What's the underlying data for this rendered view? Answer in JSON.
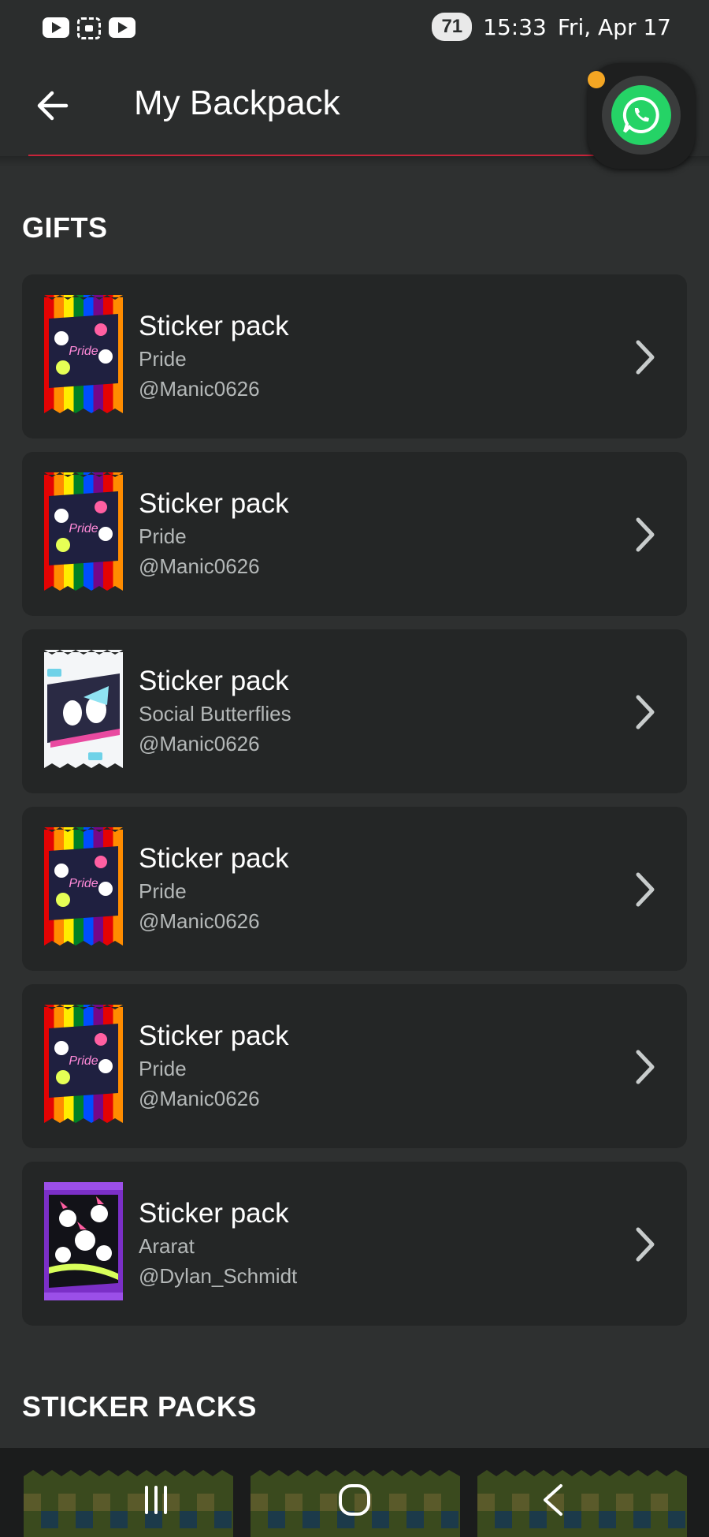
{
  "status_bar": {
    "icons": [
      "youtube-icon",
      "screenshot-icon",
      "youtube-icon"
    ],
    "battery": "71",
    "time": "15:33",
    "date": "Fri, Apr 17"
  },
  "app_bar": {
    "title": "My Backpack",
    "back_icon": "arrow-left-icon"
  },
  "floating_button": {
    "icon": "whatsapp-icon",
    "color": "#25d366"
  },
  "gifts": {
    "header": "GIFTS",
    "items": [
      {
        "title": "Sticker pack",
        "pack": "Pride",
        "user": "@Manic0626",
        "thumb": "pride"
      },
      {
        "title": "Sticker pack",
        "pack": "Pride",
        "user": "@Manic0626",
        "thumb": "pride"
      },
      {
        "title": "Sticker pack",
        "pack": "Social Butterflies",
        "user": "@Manic0626",
        "thumb": "butterflies"
      },
      {
        "title": "Sticker pack",
        "pack": "Pride",
        "user": "@Manic0626",
        "thumb": "pride"
      },
      {
        "title": "Sticker pack",
        "pack": "Pride",
        "user": "@Manic0626",
        "thumb": "pride"
      },
      {
        "title": "Sticker pack",
        "pack": "Ararat",
        "user": "@Dylan_Schmidt",
        "thumb": "ararat"
      }
    ]
  },
  "sticker_packs": {
    "header": "STICKER PACKS"
  },
  "nav_bar": {
    "buttons": [
      "recents-icon",
      "home-icon",
      "back-icon"
    ]
  },
  "colors": {
    "background": "#2e3030",
    "card": "#242626",
    "accent_red": "#c8243a",
    "secondary_text": "#b4b8b8"
  }
}
